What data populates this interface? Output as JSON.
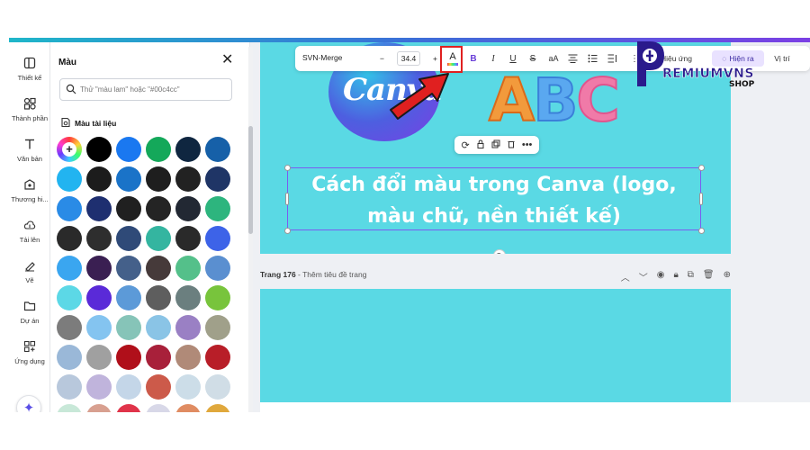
{
  "rail": {
    "items": [
      {
        "label": "Thiết kế",
        "icon": "layout-icon"
      },
      {
        "label": "Thành phần",
        "icon": "elements-icon"
      },
      {
        "label": "Văn bản",
        "icon": "text-icon"
      },
      {
        "label": "Thương hi...",
        "icon": "brand-icon"
      },
      {
        "label": "Tải lên",
        "icon": "upload-icon"
      },
      {
        "label": "Vẽ",
        "icon": "draw-icon"
      },
      {
        "label": "Dự án",
        "icon": "folder-icon"
      },
      {
        "label": "Ứng dụng",
        "icon": "apps-icon"
      }
    ]
  },
  "color_panel": {
    "title": "Màu",
    "search_placeholder": "Thử \"màu lam\" hoặc \"#00c4cc\"",
    "section_title": "Màu tài liệu",
    "swatches": [
      "add",
      "#000000",
      "#1a78f0",
      "#14a85a",
      "#0f2640",
      "#1660a8",
      "#22b4f0",
      "#1c1c1c",
      "#1a73c8",
      "#1e1e1e",
      "#222222",
      "#1f3566",
      "#2a8be6",
      "#1e2f70",
      "#202020",
      "#242424",
      "#222833",
      "#2db57e",
      "#2a2a2a",
      "#2e2e2e",
      "#2f4a78",
      "#34b5a0",
      "#2a2a2a",
      "#3d63e8",
      "#3aa6f0",
      "#3a1f52",
      "#44608a",
      "#463a3a",
      "#54c08a",
      "#5a8fd0",
      "#5cd8e6",
      "#5a2ad8",
      "#5c9ad8",
      "#5e5e5e",
      "#6b7f7f",
      "#78c43c",
      "#7c7c7c",
      "#84c4f0",
      "#86c4b8",
      "#8ac4e6",
      "#9a80c4",
      "#a0a08a",
      "#9ab8d8",
      "#a0a0a0",
      "#b00f1a",
      "#a8203a",
      "#b08a78",
      "#b81e28",
      "#b8c8dc",
      "#c0b4dc",
      "#c4d6e8",
      "#cc5a4a",
      "#ccdde8",
      "#d0dde6",
      "#c8e8d8",
      "#d8a090",
      "#e0344a",
      "#d8d8e8",
      "#e08c62",
      "#e0a83c"
    ]
  },
  "toolbar": {
    "font": "SVN-Merge",
    "minus": "−",
    "size": "34.4",
    "plus": "+",
    "text_color_letter": "A",
    "bold": "B",
    "italic": "I",
    "underline": "U",
    "strike": "S",
    "case": "aA",
    "effects": "Hiệu ứng",
    "animate": "Hiện ra",
    "position": "Vị trí"
  },
  "canvas": {
    "canva_logo_text": "Canva",
    "abc_a": "A",
    "abc_b": "B",
    "abc_c": "C",
    "heading": "Cách đổi màu trong Canva (logo, màu chữ, nền thiết kế)",
    "page2_number": "Trang 176",
    "page2_title": " - Thêm tiêu đề trang"
  },
  "watermark": {
    "name": "REMIUMVNS",
    "shop": "SHOP"
  },
  "colors": {
    "accent": "#7b5cf0",
    "canvas_bg": "#5ad9e4",
    "highlight": "#e02020"
  }
}
